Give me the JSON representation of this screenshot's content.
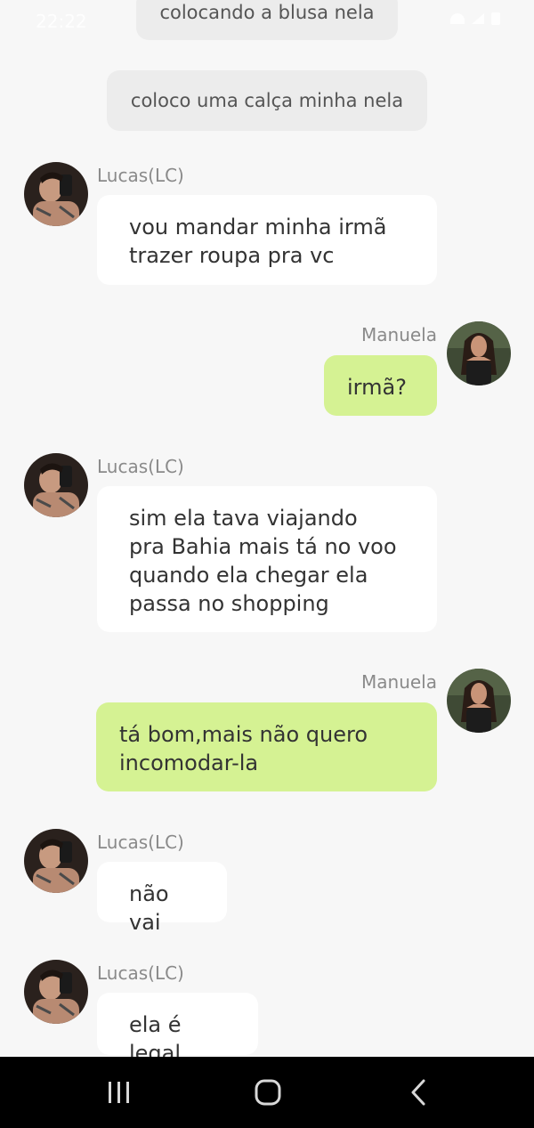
{
  "status_bar": {
    "time": "22:22"
  },
  "system_messages": [
    "colocando a blusa nela",
    "coloco uma calça minha nela"
  ],
  "messages": [
    {
      "sender": "Lucas(LC)",
      "direction": "incoming",
      "lines": [
        "vou mandar minha irmã",
        "trazer roupa pra vc"
      ]
    },
    {
      "sender": "Manuela",
      "direction": "outgoing",
      "lines": [
        "irmã?"
      ]
    },
    {
      "sender": "Lucas(LC)",
      "direction": "incoming",
      "lines": [
        "sim ela tava viajando",
        "pra Bahia mais tá no voo",
        "quando ela chegar ela",
        "passa no shopping"
      ]
    },
    {
      "sender": "Manuela",
      "direction": "outgoing",
      "lines": [
        "tá bom,mais não quero",
        "incomodar-la"
      ]
    },
    {
      "sender": "Lucas(LC)",
      "direction": "incoming",
      "lines": [
        "não vai"
      ]
    },
    {
      "sender": "Lucas(LC)",
      "direction": "incoming",
      "lines": [
        "ela é legal"
      ]
    }
  ],
  "colors": {
    "background": "#f7f7f7",
    "incoming_bubble": "#ffffff",
    "outgoing_bubble": "#d5f293",
    "system_bubble": "#ececec",
    "navbar": "#000000"
  },
  "navbar": {
    "icons": [
      "recent-apps-icon",
      "home-icon",
      "back-icon"
    ]
  }
}
